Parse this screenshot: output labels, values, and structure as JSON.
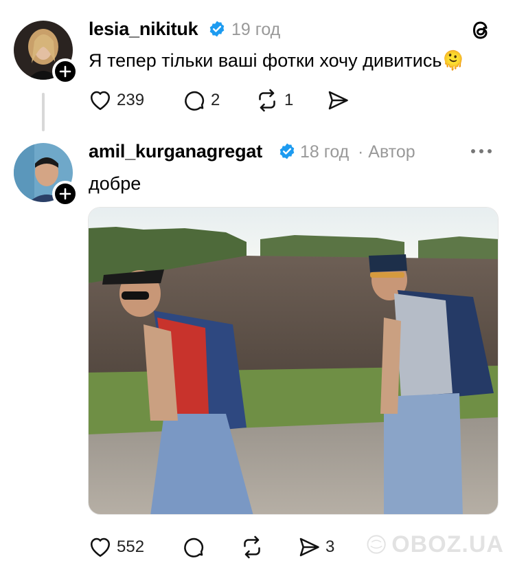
{
  "post1": {
    "username": "lesia_nikituk",
    "time": "19 год",
    "text": "Я тепер тільки ваші фотки хочу дивитись",
    "emoji": "🫠",
    "likes": "239",
    "comments": "2",
    "reposts": "1",
    "shares": ""
  },
  "post2": {
    "username": "amil_kurganagregat",
    "time": "18 год",
    "author_label": "· Автор",
    "text": "добре",
    "likes": "552",
    "comments": "",
    "reposts": "",
    "shares": "3"
  },
  "watermark": "OBOZ.UA",
  "icons": {
    "app_logo": "threads-logo-icon",
    "more": "more-dots-icon",
    "verified": "verified-badge-icon",
    "like": "heart-icon",
    "comment": "comment-bubble-icon",
    "repost": "repost-icon",
    "share": "send-icon",
    "follow": "plus-icon"
  },
  "colors": {
    "verified_blue": "#1d9bf0",
    "meta_gray": "#999999"
  }
}
